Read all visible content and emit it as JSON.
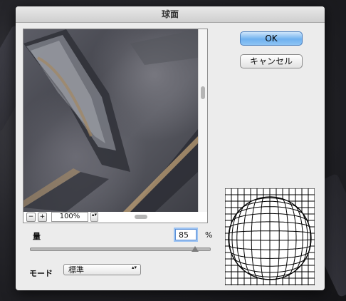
{
  "dialog": {
    "title": "球面",
    "ok_label": "OK",
    "cancel_label": "キャンセル"
  },
  "preview": {
    "zoom_minus": "−",
    "zoom_plus": "+",
    "zoom_value": "100%",
    "zoom_stepper": "▴▾"
  },
  "amount": {
    "label": "量",
    "value": "85",
    "unit": "%",
    "slider_fraction": 0.92
  },
  "mode": {
    "label": "モード",
    "selected": "標準",
    "arrow": "▴▾"
  },
  "colors": {
    "ok_button": "#6fb1ef",
    "dialog_bg": "#ececec"
  }
}
